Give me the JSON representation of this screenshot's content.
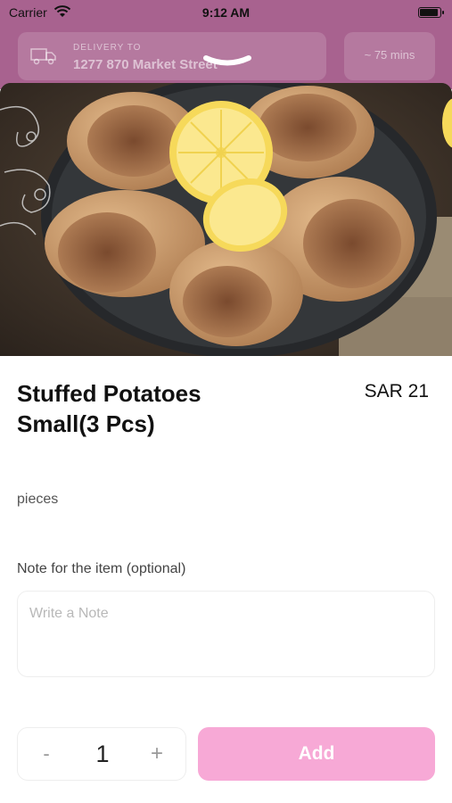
{
  "status_bar": {
    "carrier": "Carrier",
    "time": "9:12 AM"
  },
  "header": {
    "delivery_label": "DELIVERY TO",
    "delivery_address": "1277 870 Market Street",
    "eta": "~ 75 mins"
  },
  "product": {
    "name": "Stuffed Potatoes Small(3 Pcs)",
    "price": "SAR 21",
    "description": "pieces"
  },
  "note": {
    "label": "Note for the item (optional)",
    "placeholder": "Write a Note",
    "value": ""
  },
  "quantity": {
    "minus": "-",
    "value": "1",
    "plus": "+"
  },
  "actions": {
    "add_label": "Add"
  },
  "colors": {
    "accent": "#f7a9d6",
    "overlay": "#a8628f"
  },
  "icons": [
    "wifi-icon",
    "battery-icon",
    "truck-icon",
    "chevron-down-icon"
  ]
}
